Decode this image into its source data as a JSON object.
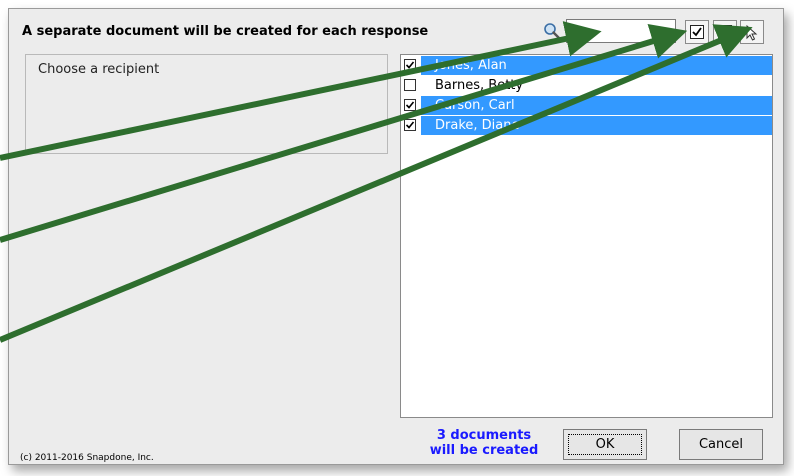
{
  "header": {
    "message": "A separate document will be created for each response",
    "search": {
      "value": "",
      "placeholder": ""
    },
    "icons": [
      "search-icon",
      "check-all-icon",
      "uncheck-all-icon",
      "cursor-select-icon"
    ]
  },
  "left_panel": {
    "prompt": "Choose a recipient"
  },
  "recipients": [
    {
      "name": "Jones, Alan",
      "checked": true,
      "selected": true
    },
    {
      "name": "Barnes, Betty",
      "checked": false,
      "selected": false
    },
    {
      "name": "Carson, Carl",
      "checked": true,
      "selected": true
    },
    {
      "name": "Drake, Diane",
      "checked": true,
      "selected": true
    }
  ],
  "footer": {
    "doc_count_line1": "3 documents",
    "doc_count_line2": "will be created",
    "ok_label": "OK",
    "cancel_label": "Cancel",
    "copyright": "(c) 2011-2016 Snapdone, Inc."
  },
  "colors": {
    "selection": "#3399ff",
    "doc_count_text": "#1a1aff",
    "annotation_arrow": "#2e6e2e"
  }
}
